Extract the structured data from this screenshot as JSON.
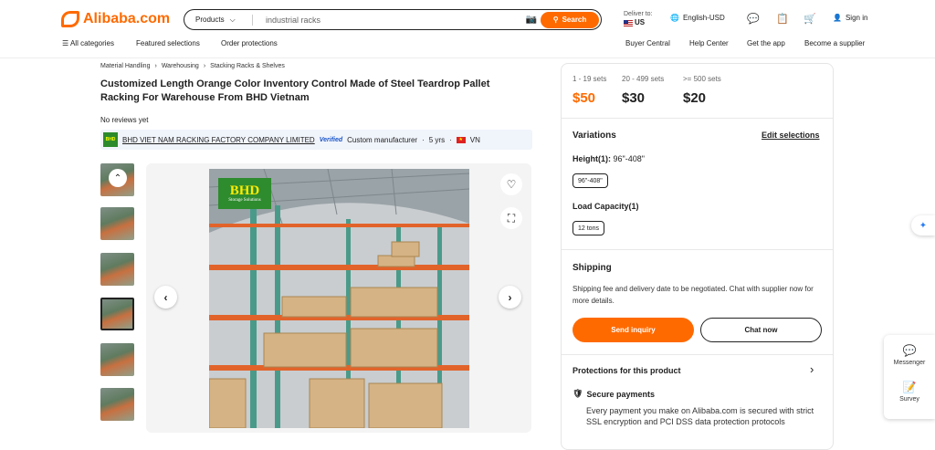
{
  "header": {
    "logo_text": "Alibaba.com",
    "search_category": "Products",
    "search_query": "industrial racks",
    "search_button": "Search",
    "deliver_label": "Deliver to:",
    "deliver_country": "US",
    "language": "English-USD",
    "sign_in": "Sign in"
  },
  "subnav": {
    "all_categories": "All categories",
    "featured": "Featured selections",
    "order_protections": "Order protections",
    "buyer_central": "Buyer Central",
    "help_center": "Help Center",
    "get_app": "Get the app",
    "become_supplier": "Become a supplier"
  },
  "breadcrumb": [
    "Material Handling",
    "Warehousing",
    "Stacking Racks & Shelves"
  ],
  "product": {
    "title": "Customized Length Orange Color Inventory Control Made of Steel Teardrop Pallet Racking For Warehouse From BHD Vietnam",
    "reviews": "No reviews yet",
    "image_brand": "BHD",
    "image_brand_sub": "Storage Solutions"
  },
  "supplier": {
    "logo_text": "BHD",
    "name": "BHD VIET NAM RACKING FACTORY COMPANY LIMITED",
    "verified": "Verified",
    "type": "Custom manufacturer",
    "years": "5 yrs",
    "country": "VN"
  },
  "pricing": {
    "tiers": [
      {
        "range": "1 - 19 sets",
        "price": "$50"
      },
      {
        "range": "20 - 499 sets",
        "price": "$30"
      },
      {
        "range": ">= 500 sets",
        "price": "$20"
      }
    ]
  },
  "variations": {
    "heading": "Variations",
    "edit": "Edit selections",
    "height_label": "Height(1):",
    "height_value": "96\"-408\"",
    "height_chip": "96\"-408\"",
    "capacity_label": "Load Capacity(1)",
    "capacity_chip": "12 tons"
  },
  "shipping": {
    "heading": "Shipping",
    "text": "Shipping fee and delivery date to be negotiated. Chat with supplier now for more details.",
    "send_inquiry": "Send inquiry",
    "chat_now": "Chat now"
  },
  "protections": {
    "heading": "Protections for this product",
    "secure_title": "Secure payments",
    "secure_text": "Every payment you make on Alibaba.com is secured with strict SSL encryption and PCI DSS data protection protocols"
  },
  "floating": {
    "messenger": "Messenger",
    "survey": "Survey"
  },
  "colors": {
    "brand": "#ff6a00",
    "verified": "#1a56c8"
  }
}
